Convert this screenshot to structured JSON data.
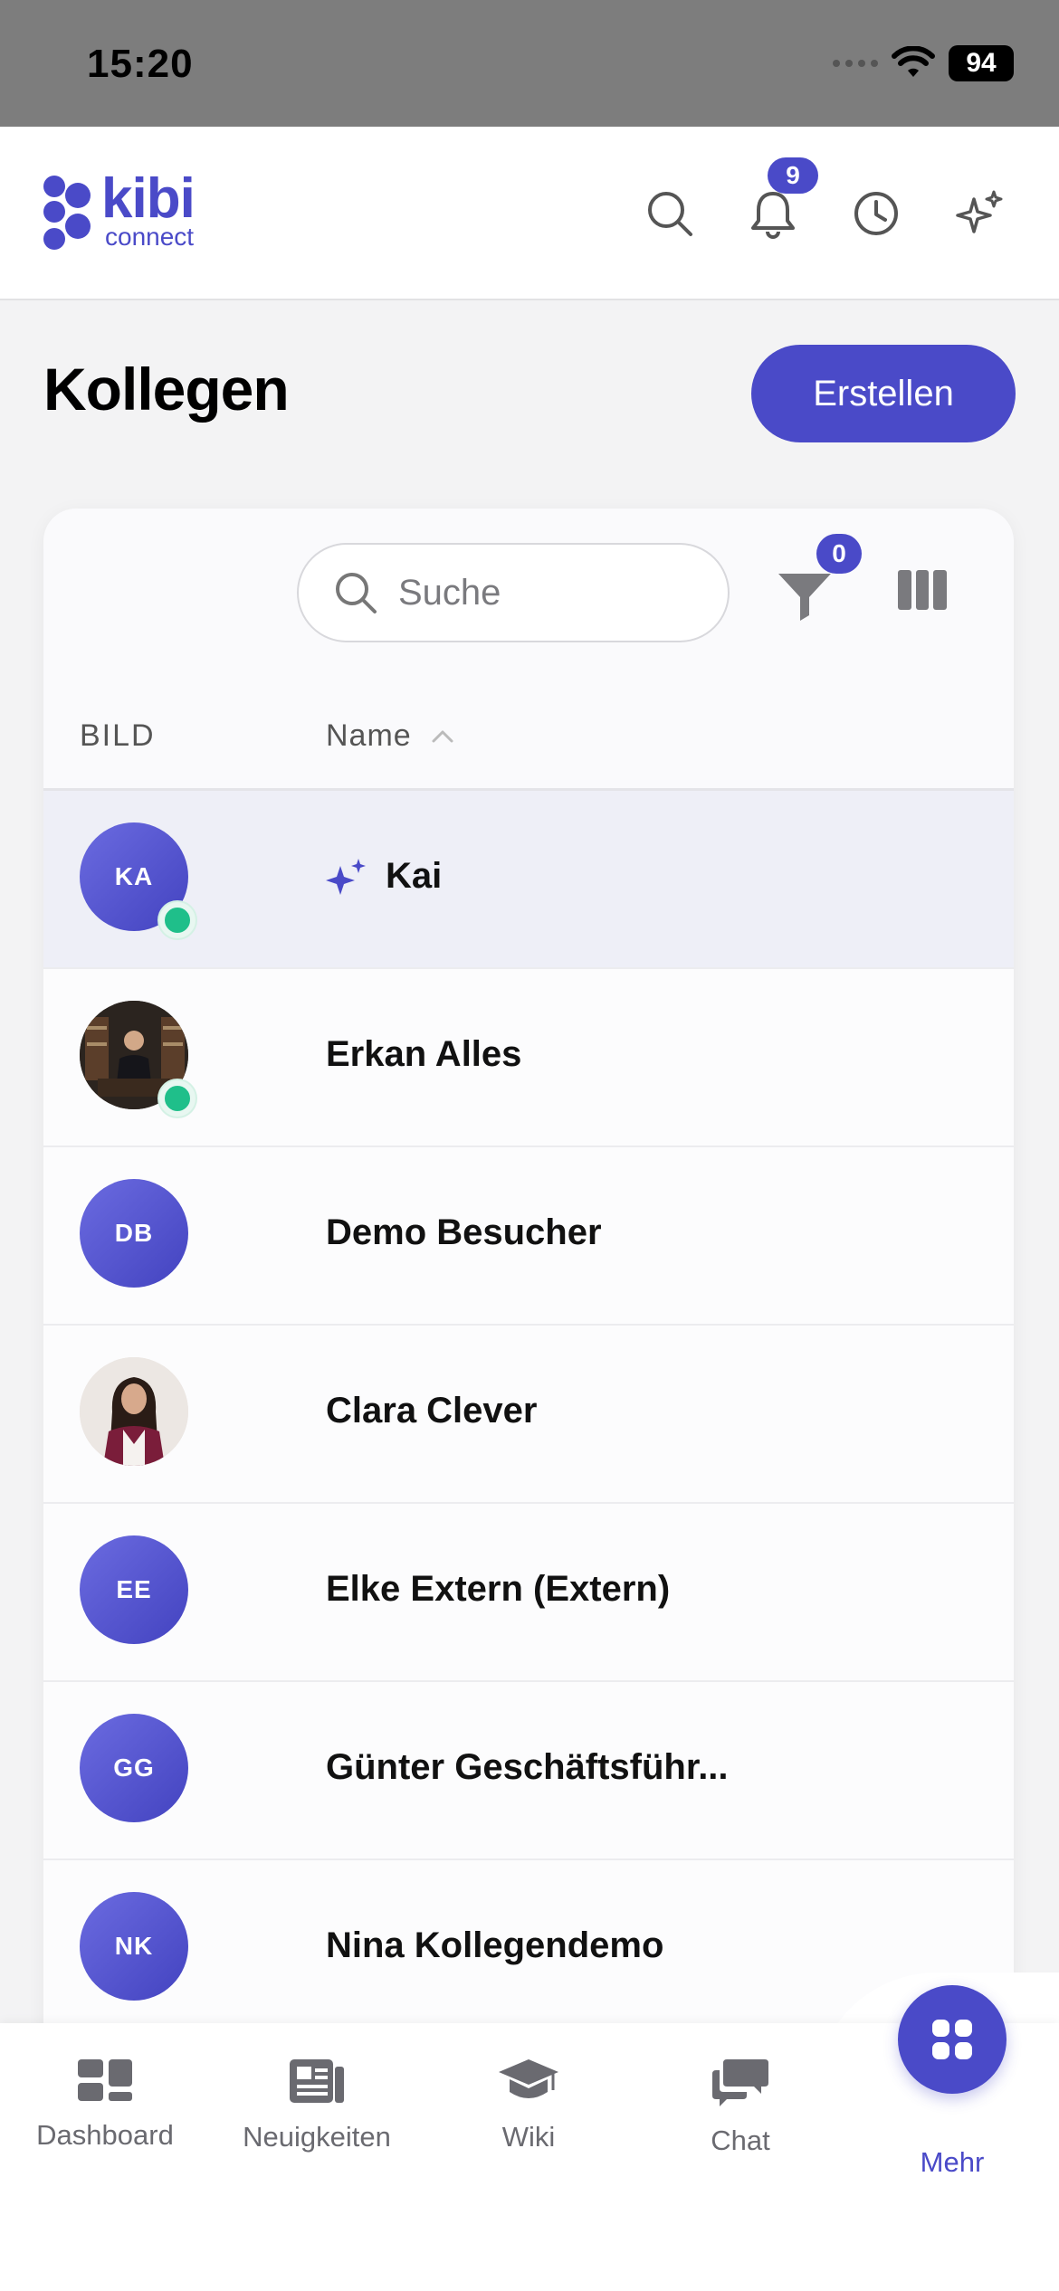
{
  "status_bar": {
    "time": "15:20",
    "battery": "94"
  },
  "header": {
    "logo_main": "kibi",
    "logo_sub": "connect",
    "notification_count": "9"
  },
  "page": {
    "title": "Kollegen",
    "create_label": "Erstellen"
  },
  "toolbar": {
    "search_placeholder": "Suche",
    "filter_count": "0"
  },
  "table": {
    "col_picture": "BILD",
    "col_name": "Name",
    "rows": [
      {
        "initials": "KA",
        "name": "Kai",
        "online": true,
        "ai": true
      },
      {
        "initials": "",
        "name": "Erkan Alles",
        "online": true,
        "photo": true
      },
      {
        "initials": "DB",
        "name": "Demo Besucher",
        "online": false
      },
      {
        "initials": "",
        "name": "Clara Clever",
        "online": false,
        "photo": true
      },
      {
        "initials": "EE",
        "name": "Elke Extern (Extern)",
        "online": false
      },
      {
        "initials": "GG",
        "name": "Günter Geschäftsführ...",
        "online": false
      },
      {
        "initials": "NK",
        "name": "Nina Kollegendemo",
        "online": false
      }
    ]
  },
  "bottom_nav": [
    {
      "label": "Dashboard"
    },
    {
      "label": "Neuigkeiten"
    },
    {
      "label": "Wiki"
    },
    {
      "label": "Chat"
    },
    {
      "label": "Mehr"
    }
  ],
  "colors": {
    "accent": "#4a4ac8",
    "online": "#1fbf8a"
  }
}
